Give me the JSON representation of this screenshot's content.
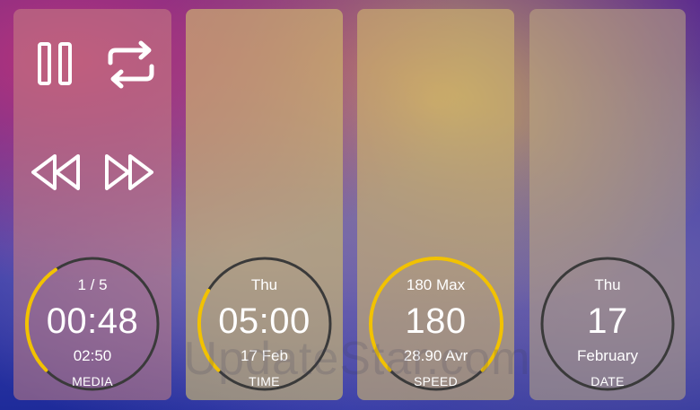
{
  "media": {
    "track": "1 / 5",
    "elapsed": "00:48",
    "duration": "02:50",
    "label": "MEDIA",
    "progress": 0.28
  },
  "time": {
    "day": "Thu",
    "clock": "05:00",
    "date": "17 Feb",
    "label": "TIME",
    "progress": 0.21
  },
  "speed": {
    "max": "180 Max",
    "value": "180",
    "average": "28.90 Avr",
    "label": "SPEED",
    "progress": 0.75
  },
  "date": {
    "day": "Thu",
    "number": "17",
    "month": "February",
    "label": "DATE",
    "progress": 0
  },
  "colors": {
    "accent": "#f2c200",
    "ring": "#3a3a3a",
    "text": "#ffffff"
  },
  "watermark": "UpdateStar.com"
}
